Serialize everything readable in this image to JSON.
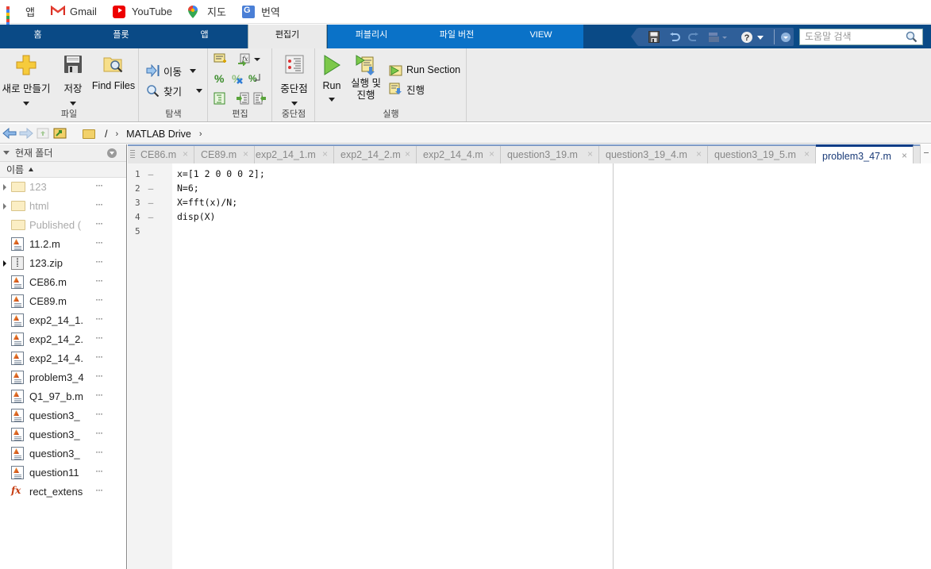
{
  "bookmarks": [
    {
      "label": "앱",
      "icon": "apps-grid-icon"
    },
    {
      "label": "Gmail",
      "icon": "gmail-icon"
    },
    {
      "label": "YouTube",
      "icon": "youtube-icon"
    },
    {
      "label": "지도",
      "icon": "maps-icon"
    },
    {
      "label": "번역",
      "icon": "translate-icon"
    }
  ],
  "top_tabs": [
    {
      "label": "홈"
    },
    {
      "label": "플롯"
    },
    {
      "label": "앱"
    },
    {
      "label": "편집기",
      "active": true
    },
    {
      "label": "퍼블리시"
    },
    {
      "label": "파일 버전"
    },
    {
      "label": "VIEW"
    }
  ],
  "quick_access": {
    "icons": [
      "save-icon",
      "undo-icon",
      "redo-icon",
      "window-switch-icon",
      "help-icon",
      "dropdown-icon"
    ],
    "search_placeholder": "도움말 검색"
  },
  "ribbon": {
    "groups": [
      {
        "label": "파일",
        "buttons": [
          "새로 만들기",
          "저장",
          "Find Files"
        ]
      },
      {
        "label": "탐색",
        "buttons": [
          "이동",
          "찾기"
        ]
      },
      {
        "label": "편집",
        "icons": [
          "insert-section-icon",
          "fx-insert-icon",
          "comment-icon",
          "uncomment-icon",
          "wrap-comment-icon",
          "smart-indent-icon",
          "indent-icon",
          "outdent-icon"
        ]
      },
      {
        "label": "중단점",
        "buttons": [
          "중단점"
        ]
      },
      {
        "label": "실행",
        "buttons": [
          "Run",
          "실행 및\n진행",
          "Run Section",
          "진행"
        ]
      }
    ],
    "new_label": "새로 만들기",
    "save_label": "저장",
    "find_files_label": "Find Files",
    "goto_label": "이동",
    "find_label": "찾기",
    "breakpoint_label": "중단점",
    "run_label": "Run",
    "run_advance_line1": "실행 및",
    "run_advance_line2": "진행",
    "run_section_label": "Run Section",
    "advance_label": "진행",
    "group_file": "파일",
    "group_navigate": "탐색",
    "group_edit": "편집",
    "group_breakpoint": "중단점",
    "group_run": "실행"
  },
  "address": {
    "root": "/",
    "segments": [
      "MATLAB Drive"
    ]
  },
  "current_folder": {
    "title": "현재 폴더",
    "column_header": "이름",
    "items": [
      {
        "name": "123",
        "type": "folder",
        "dim": true,
        "expandable": true
      },
      {
        "name": "html",
        "type": "folder",
        "dim": true,
        "expandable": true
      },
      {
        "name": "Published (",
        "type": "folder",
        "dim": true,
        "expandable": false
      },
      {
        "name": "11.2.m",
        "type": "m-file"
      },
      {
        "name": "123.zip",
        "type": "zip",
        "expandable": true
      },
      {
        "name": "CE86.m",
        "type": "m-file"
      },
      {
        "name": "CE89.m",
        "type": "m-file"
      },
      {
        "name": "exp2_14_1.",
        "type": "m-file"
      },
      {
        "name": "exp2_14_2.",
        "type": "m-file"
      },
      {
        "name": "exp2_14_4.",
        "type": "m-file"
      },
      {
        "name": "problem3_4",
        "type": "m-file"
      },
      {
        "name": "Q1_97_b.m",
        "type": "m-file"
      },
      {
        "name": "question3_",
        "type": "m-file"
      },
      {
        "name": "question3_",
        "type": "m-file"
      },
      {
        "name": "question3_",
        "type": "m-file"
      },
      {
        "name": "question11",
        "type": "m-file"
      },
      {
        "name": "rect_extens",
        "type": "function"
      }
    ],
    "more_label": "···"
  },
  "editor_tabs": [
    {
      "label": "CE86.m"
    },
    {
      "label": "CE89.m"
    },
    {
      "label": "exp2_14_1.m"
    },
    {
      "label": "exp2_14_2.m"
    },
    {
      "label": "exp2_14_4.m"
    },
    {
      "label": "question3_19.m"
    },
    {
      "label": "question3_19_4.m"
    },
    {
      "label": "question3_19_5.m"
    },
    {
      "label": "problem3_47.m",
      "active": true
    }
  ],
  "close_glyph": "×",
  "editor": {
    "lines": [
      {
        "num": "1",
        "code": "x=[1 2 0 0 0 2];",
        "exec": true
      },
      {
        "num": "2",
        "code": "N=6;",
        "exec": true
      },
      {
        "num": "3",
        "code": "X=fft(x)/N;",
        "exec": true
      },
      {
        "num": "4",
        "code": "disp(X)",
        "exec": true
      },
      {
        "num": "5",
        "code": "",
        "exec": false
      }
    ],
    "dash": "–"
  },
  "colors": {
    "tab_strip": "#0a4a86",
    "tab_strip_light": "#0a72c8",
    "ribbon_bg": "#ececec",
    "active_tab_border": "#0b3c86"
  }
}
